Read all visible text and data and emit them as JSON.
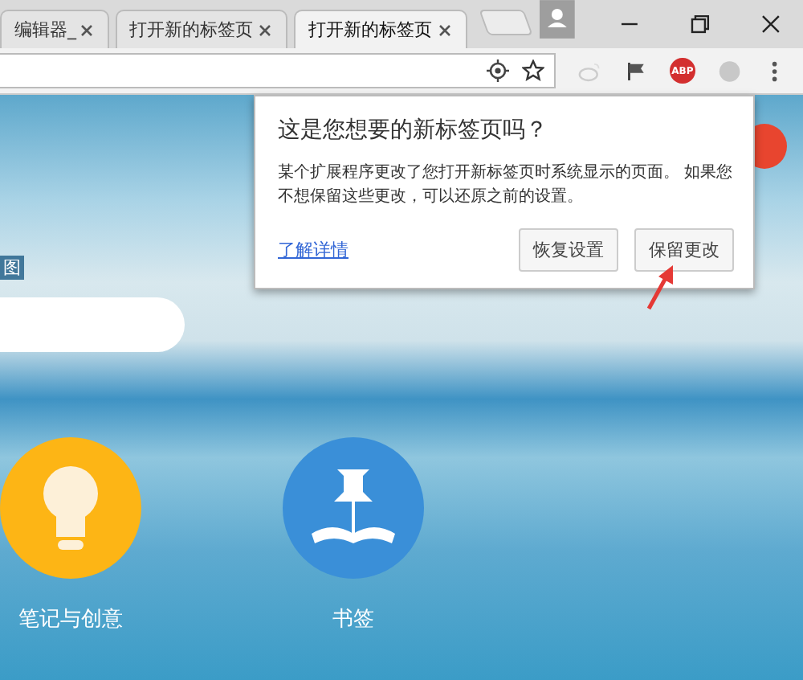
{
  "tabs": [
    {
      "title": "编辑器_",
      "selected": false
    },
    {
      "title": "打开新的标签页",
      "selected": false
    },
    {
      "title": "打开新的标签页",
      "selected": true
    }
  ],
  "toolbar": {
    "abp_badge": "ABP"
  },
  "page": {
    "map_link": "图",
    "apps": [
      {
        "label": "笔记与创意",
        "kind": "idea"
      },
      {
        "label": "书签",
        "kind": "bookmark"
      }
    ]
  },
  "bubble": {
    "title": "这是您想要的新标签页吗？",
    "message": "某个扩展程序更改了您打开新标签页时系统显示的页面。 如果您不想保留这些更改，可以还原之前的设置。",
    "link": "了解详情",
    "buttons": [
      "恢复设置",
      "保留更改"
    ]
  }
}
